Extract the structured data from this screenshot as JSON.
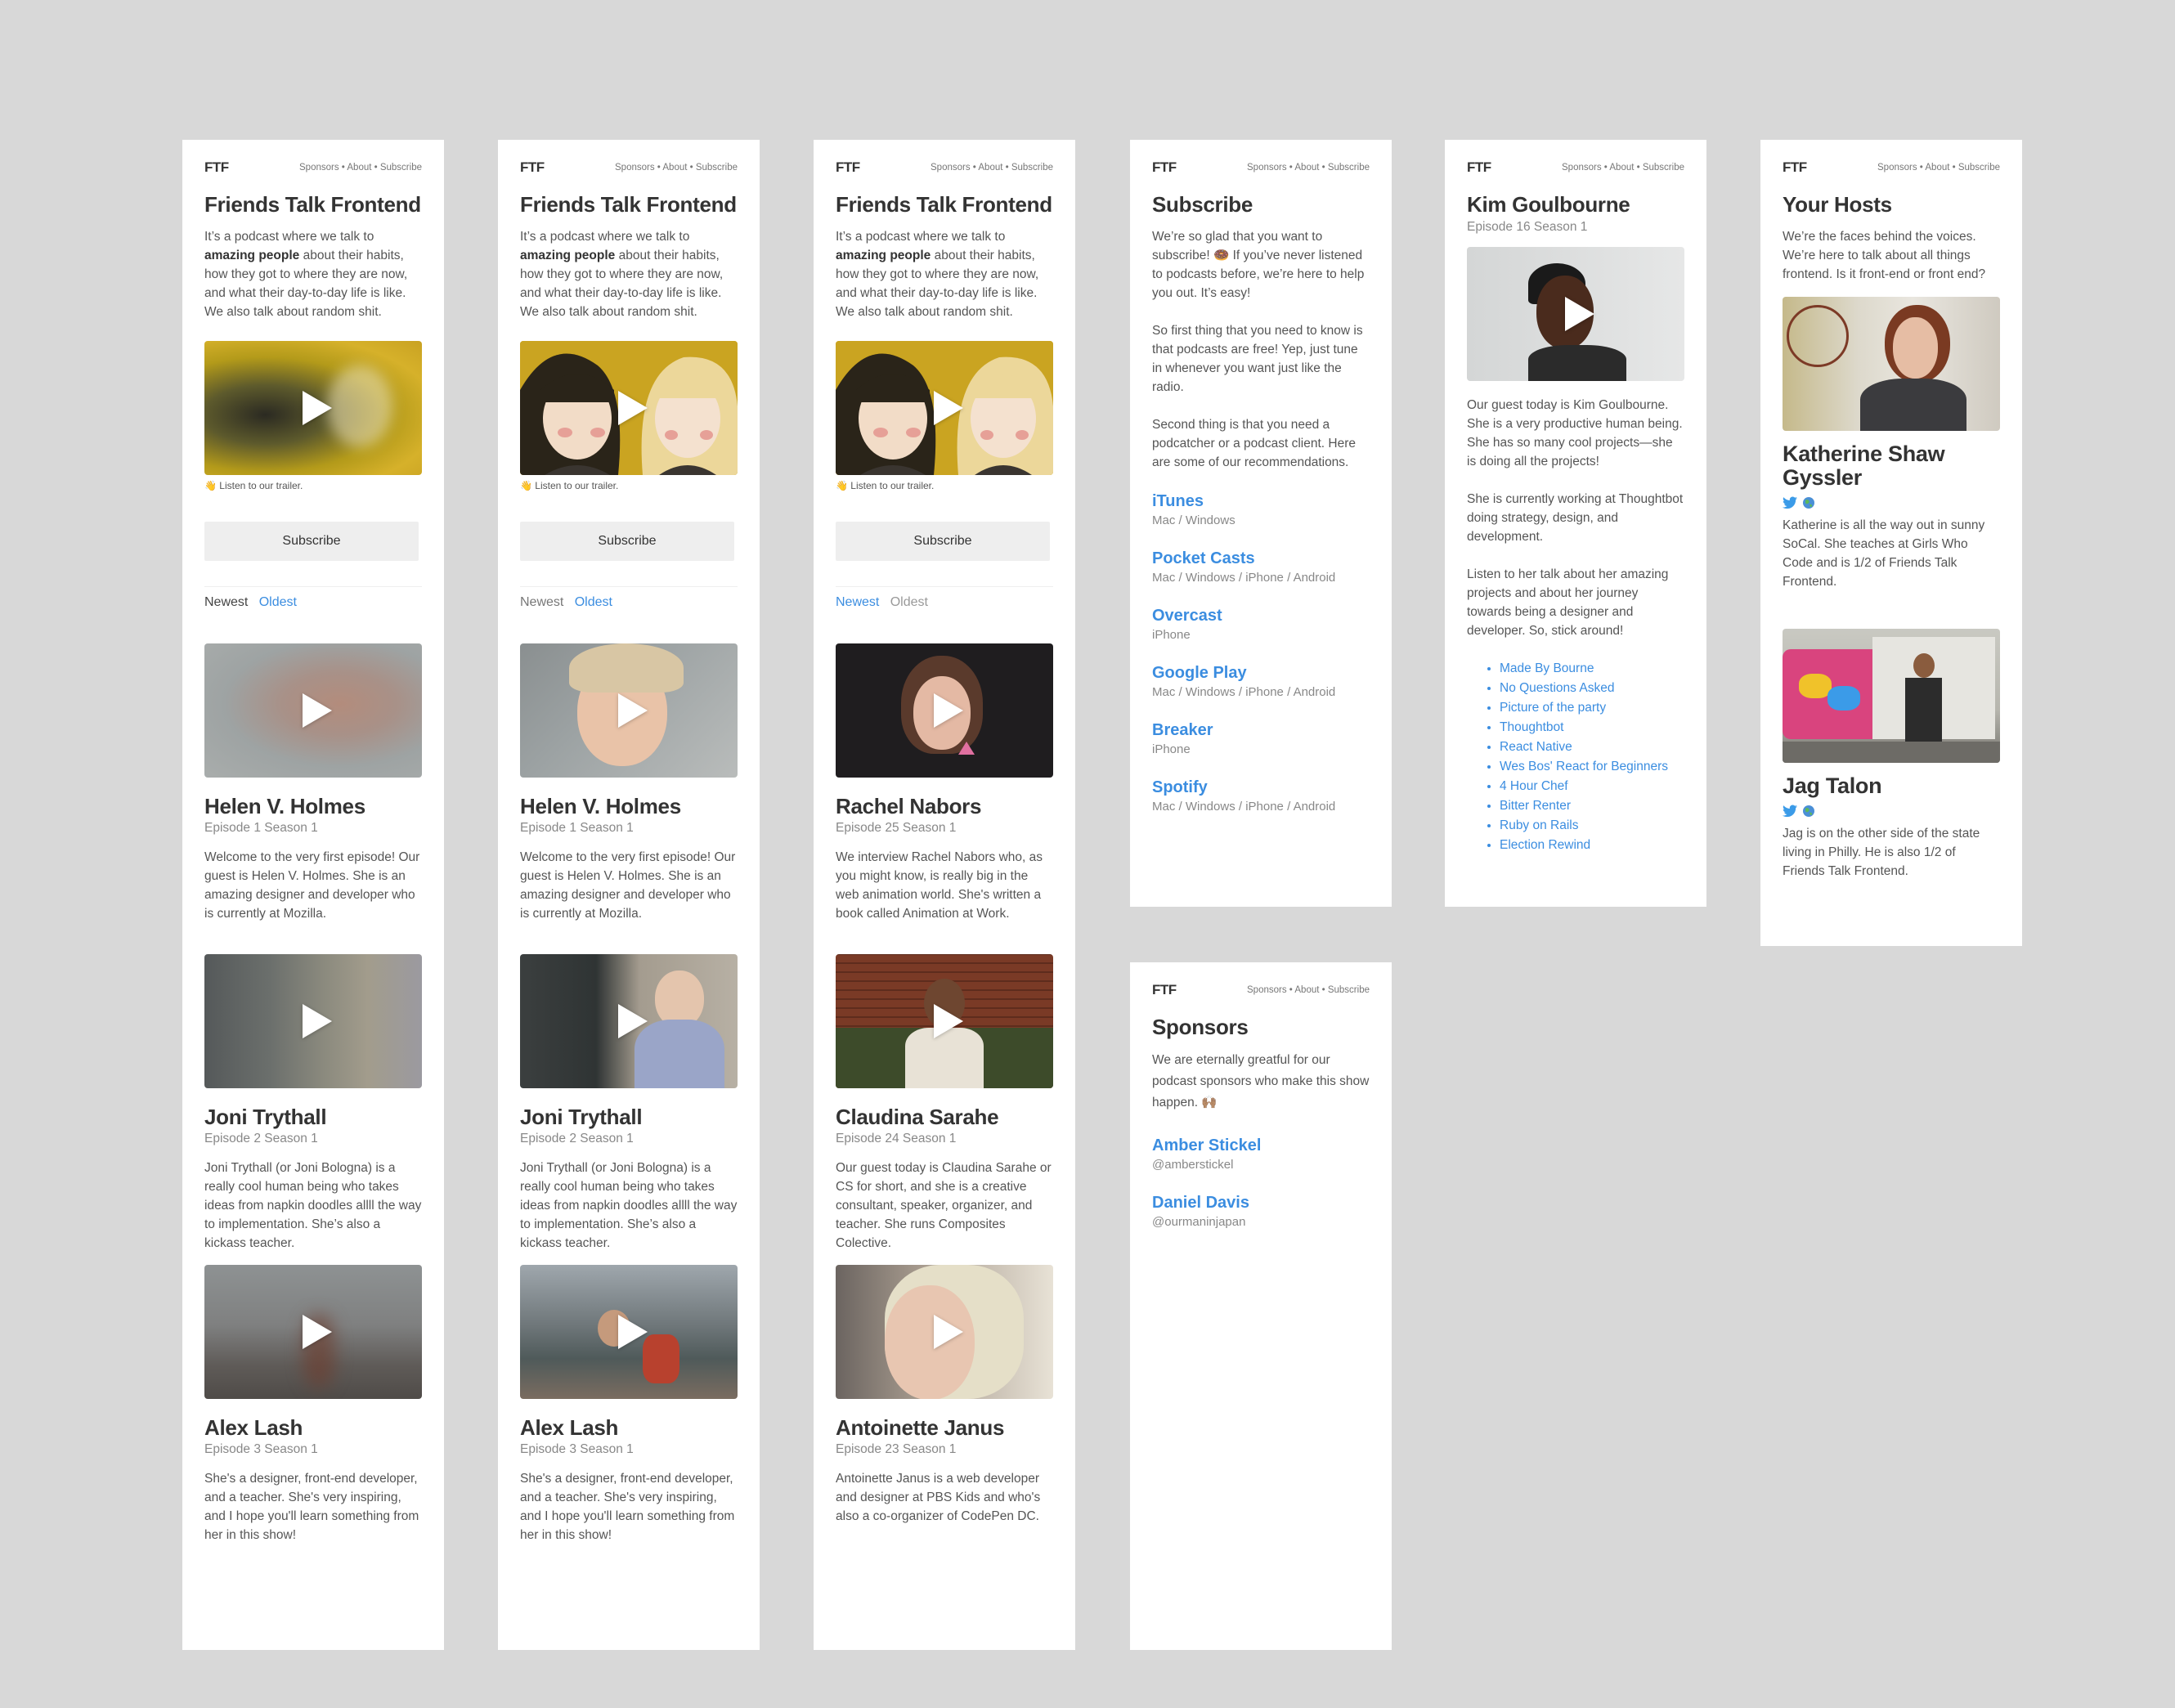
{
  "nav": {
    "logo": "FTF",
    "links": "Sponsors • About • Subscribe"
  },
  "home": {
    "title": "Friends Talk Frontend",
    "intro_a": "It’s a podcast where we talk to ",
    "intro_bold": "amazing people",
    "intro_b": " about their habits, how they got to where they are now, and what their day-to-day life is like. We also talk about random shit.",
    "trailer_emoji": "👋",
    "trailer": "Listen to our trailer.",
    "subscribe_label": "Subscribe",
    "filter_newest": "Newest",
    "filter_oldest": "Oldest"
  },
  "episodes_asc": [
    {
      "name": "Helen V. Holmes",
      "meta": "Episode 1 Season 1",
      "desc": "Welcome to the very first episode! Our guest is Helen V. Holmes. She is an amazing designer and developer who is currently at Mozilla."
    },
    {
      "name": "Joni Trythall",
      "meta": "Episode 2 Season 1",
      "desc": "Joni Trythall (or Joni Bologna) is a really cool human being who takes ideas from napkin doodles allll the way to implementation. She’s also a kickass teacher."
    },
    {
      "name": "Alex Lash",
      "meta": "Episode 3 Season 1",
      "desc": "She's a designer, front-end developer, and a teacher. She's very inspiring, and I hope you'll learn something from her in this show!"
    }
  ],
  "episodes_desc": [
    {
      "name": "Rachel Nabors",
      "meta": "Episode 25 Season 1",
      "desc": "We interview Rachel Nabors who, as you might know, is really big in the web animation world.  She's written a book called Animation at Work."
    },
    {
      "name": "Claudina Sarahe",
      "meta": "Episode 24 Season 1",
      "desc": "Our guest today is Claudina Sarahe or CS for short, and she is a creative consultant, speaker, organizer, and teacher. She runs Composites Colective."
    },
    {
      "name": "Antoinette Janus",
      "meta": "Episode 23 Season 1",
      "desc": "Antoinette Janus is a web developer and designer at PBS Kids and who's also a co-organizer of CodePen DC."
    }
  ],
  "subscribe_page": {
    "title": "Subscribe",
    "p1_a": "We’re so glad that you want to subscribe!",
    "p1_emoji": "🍩",
    "p1_b": "If you’ve never listened to podcasts before, we’re here to help you out. It’s easy!",
    "p2": "So first thing that you need to know is that podcasts are free! Yep, just tune in whenever you want just like the radio.",
    "p3": "Second thing is that you need a podcatcher or a podcast client. Here are some of our recommendations.",
    "apps": [
      {
        "name": "iTunes",
        "platforms": "Mac / Windows"
      },
      {
        "name": "Pocket Casts",
        "platforms": "Mac / Windows / iPhone / Android"
      },
      {
        "name": "Overcast",
        "platforms": "iPhone"
      },
      {
        "name": "Google Play",
        "platforms": "Mac / Windows / iPhone / Android"
      },
      {
        "name": "Breaker",
        "platforms": "iPhone"
      },
      {
        "name": "Spotify",
        "platforms": "Mac / Windows / iPhone / Android"
      }
    ]
  },
  "sponsors_page": {
    "title": "Sponsors",
    "intro": "We are eternally greatful for our podcast sponsors who make this show happen.",
    "intro_emoji": "🙌🏽",
    "sponsors": [
      {
        "name": "Amber Stickel",
        "handle": "@ambersticke​l"
      },
      {
        "name": "Daniel Davis",
        "handle": "@ourmaninjapan"
      }
    ]
  },
  "episode_page": {
    "name": "Kim Goulbourne",
    "meta": "Episode 16 Season 1",
    "p1": "Our guest today is Kim Goulbourne. She is a very productive human being. She has so many cool projects—she is doing all the projects!",
    "p2": "She is currently working at Thoughtbot doing strategy, design, and development.",
    "p3": "Listen to her talk about her amazing projects and about her journey towards being a designer and developer. So, stick around!",
    "links": [
      "Made By Bourne",
      "No Questions Asked",
      "Picture of the party",
      "Thoughtbot",
      "React Native",
      "Wes Bos' React for Beginners",
      "4 Hour Chef",
      "Bitter Renter",
      "Ruby on Rails",
      "Election Rewind"
    ]
  },
  "hosts_page": {
    "title": "Your Hosts",
    "intro": "We’re the faces behind the voices. We’re here to talk about all things frontend. Is it front-end or front end?",
    "hosts": [
      {
        "name": "Katherine Shaw Gyssler",
        "bio": "Katherine is all the way out in sunny SoCal. She teaches at Girls Who Code and is 1/2 of Friends Talk Frontend."
      },
      {
        "name": "Jag Talon",
        "bio": "Jag is on the other side of the state living in Philly. He is also 1/2 of Friends Talk Frontend."
      }
    ]
  },
  "icons": {
    "twitter": "twitter-icon",
    "globe": "globe-icon",
    "play": "play-icon"
  },
  "colors": {
    "accent": "#3b8de0",
    "background": "#d8d8d8",
    "button": "#eeeeee"
  }
}
